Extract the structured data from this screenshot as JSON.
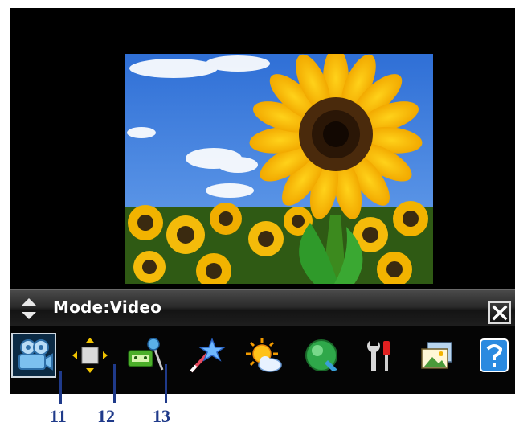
{
  "mode_bar": {
    "label": "Mode:Video"
  },
  "toolbar": {
    "tools": [
      {
        "name": "video-camera-icon",
        "selected": true
      },
      {
        "name": "resize-arrows-icon",
        "selected": false
      },
      {
        "name": "voice-recorder-icon",
        "selected": false
      },
      {
        "name": "magic-wand-icon",
        "selected": false
      },
      {
        "name": "sun-cloud-icon",
        "selected": false
      },
      {
        "name": "green-lens-icon",
        "selected": false
      },
      {
        "name": "tools-icon",
        "selected": false
      },
      {
        "name": "gallery-icon",
        "selected": false
      },
      {
        "name": "help-icon",
        "selected": false
      }
    ]
  },
  "callouts": [
    "11",
    "12",
    "13"
  ]
}
